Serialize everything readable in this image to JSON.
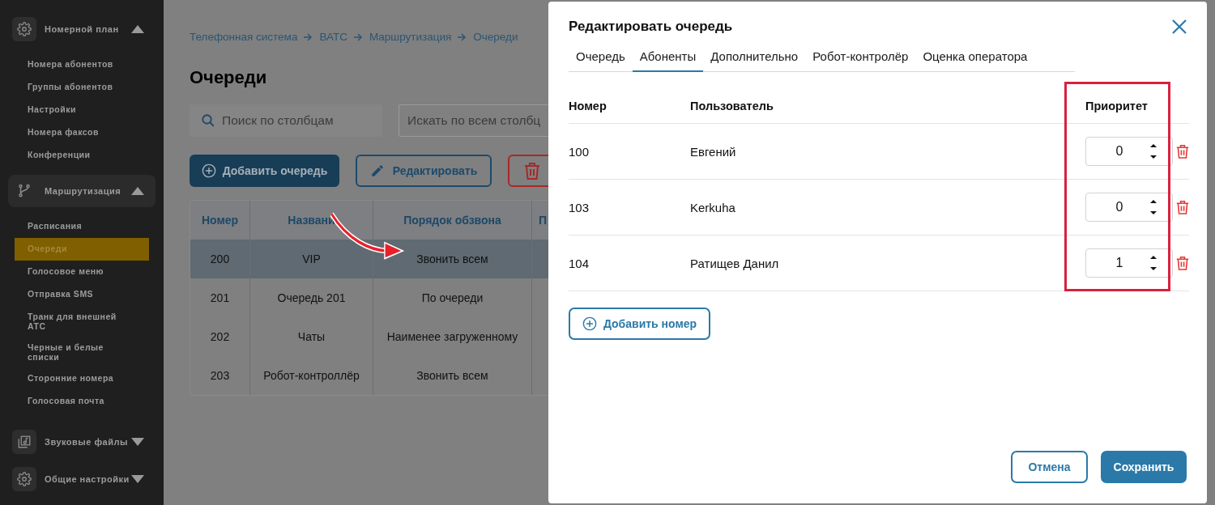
{
  "sidebar": {
    "groups": [
      {
        "label": "Номерной план",
        "expanded": true,
        "selected": false,
        "items": [
          {
            "label": "Номера абонентов",
            "selected": false
          },
          {
            "label": "Группы абонентов",
            "selected": false
          },
          {
            "label": "Настройки",
            "selected": false
          },
          {
            "label": "Номера факсов",
            "selected": false
          },
          {
            "label": "Конференции",
            "selected": false
          }
        ]
      },
      {
        "label": "Маршрутизация",
        "expanded": true,
        "selected": true,
        "items": [
          {
            "label": "Расписания",
            "selected": false
          },
          {
            "label": "Очереди",
            "selected": true
          },
          {
            "label": "Голосовое меню",
            "selected": false
          },
          {
            "label": "Отправка SMS",
            "selected": false
          },
          {
            "label": "Транк для внешней АТС",
            "selected": false
          },
          {
            "label": "Черные и белые списки",
            "selected": false
          },
          {
            "label": "Сторонние номера",
            "selected": false
          },
          {
            "label": "Голосовая почта",
            "selected": false
          }
        ]
      },
      {
        "label": "Звуковые файлы",
        "expanded": false,
        "selected": false
      },
      {
        "label": "Общие настройки",
        "expanded": false,
        "selected": false
      }
    ]
  },
  "breadcrumbs": [
    "Телефонная система",
    "ВАТС",
    "Маршрутизация",
    "Очереди"
  ],
  "page_title": "Очереди",
  "column_search": {
    "placeholder": "Поиск по столбцам"
  },
  "global_search": {
    "placeholder": "Искать по всем столбц"
  },
  "toolbar": {
    "add_label": "Добавить очередь",
    "edit_label": "Редактировать"
  },
  "table": {
    "columns": [
      "Номер",
      "Названи",
      "Порядок обзвона",
      "П"
    ],
    "rows": [
      {
        "cells": [
          "200",
          "VIP",
          "Звонить всем"
        ],
        "selected": true
      },
      {
        "cells": [
          "201",
          "Очередь 201",
          "По очереди"
        ],
        "selected": false
      },
      {
        "cells": [
          "202",
          "Чаты",
          "Наименее загруженному"
        ],
        "selected": false
      },
      {
        "cells": [
          "203",
          "Робот-контроллёр",
          "Звонить всем"
        ],
        "selected": false
      }
    ]
  },
  "dialog": {
    "title": "Редактировать очередь",
    "tabs": [
      {
        "label": "Очередь",
        "selected": false
      },
      {
        "label": "Абоненты",
        "selected": true
      },
      {
        "label": "Дополнительно",
        "selected": false
      },
      {
        "label": "Робот-контролёр",
        "selected": false
      },
      {
        "label": "Оценка оператора",
        "selected": false
      }
    ],
    "columns": [
      "Номер",
      "Пользователь",
      "Приоритет"
    ],
    "rows": [
      {
        "number": "100",
        "user": "Евгений",
        "priority": "0"
      },
      {
        "number": "103",
        "user": "Kerkuha",
        "priority": "0"
      },
      {
        "number": "104",
        "user": "Ратищев Данил",
        "priority": "1"
      }
    ],
    "add_label": "Добавить номер",
    "cancel_label": "Отмена",
    "save_label": "Сохранить"
  }
}
